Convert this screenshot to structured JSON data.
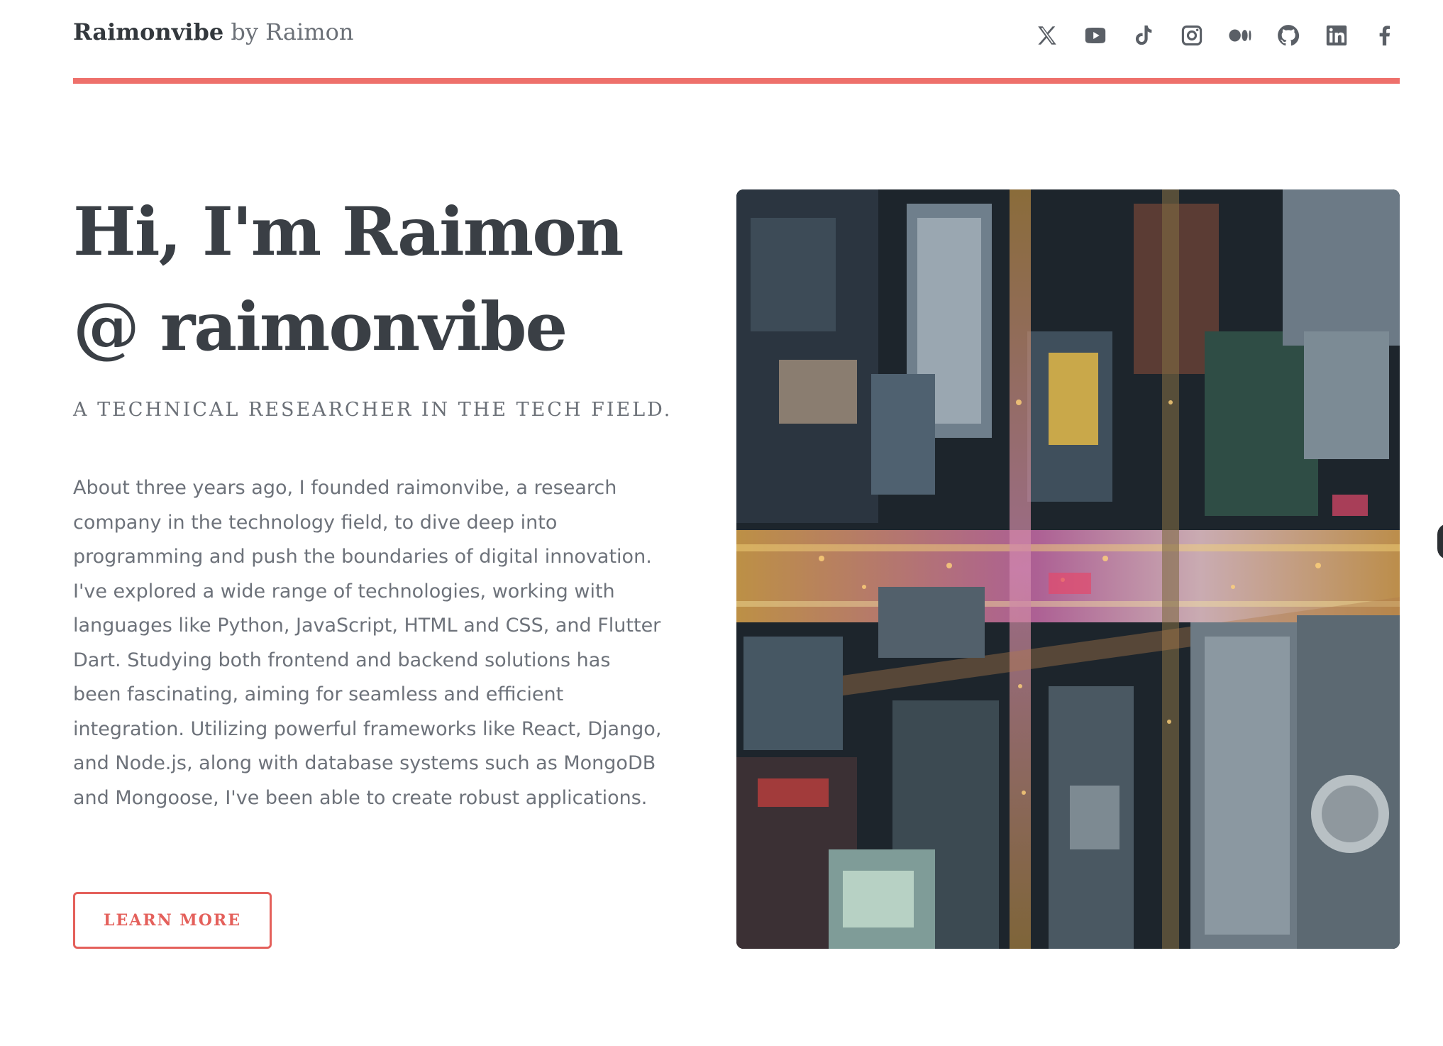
{
  "header": {
    "brand_name": "Raimonvibe",
    "brand_suffix": " by Raimon",
    "social_icons": [
      "x-icon",
      "youtube-icon",
      "tiktok-icon",
      "instagram-icon",
      "medium-icon",
      "github-icon",
      "linkedin-icon",
      "facebook-icon"
    ]
  },
  "hero": {
    "title_line1": "Hi, I'm Raimon",
    "title_line2": "@ raimonvibe",
    "tagline": "A TECHNICAL RESEARCHER IN THE TECH FIELD.",
    "about": "About three years ago, I founded raimonvibe, a research company in the technology field, to dive deep into programming and push the boundaries of digital innovation. I've explored a wide range of technologies, working with languages like Python, JavaScript, HTML and CSS, and Flutter Dart. Studying both frontend and backend solutions has been fascinating, aiming for seamless and efficient integration. Utilizing powerful frameworks like React, Django, and Node.js, along with database systems such as MongoDB and Mongoose, I've been able to create robust applications.",
    "cta_label": "LEARN MORE",
    "image_subject": "aerial-city-intersection-night"
  },
  "colors": {
    "accent": "#ee706b",
    "heading": "#3a3f45",
    "body_text": "#6d727a",
    "icon": "#5a5f66"
  }
}
